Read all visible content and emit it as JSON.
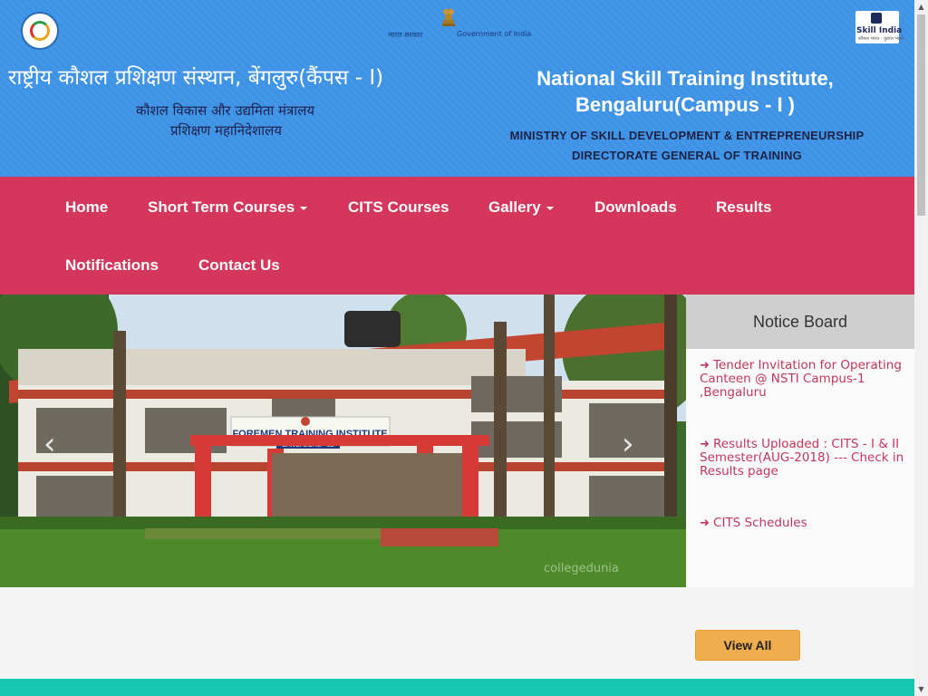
{
  "header": {
    "hindi_title": "राष्ट्रीय कौशल प्रशिक्षण संस्थान, बेंगलुरु(कैंपस - I)",
    "hindi_ministry": "कौशल विकास और उद्यमिता मंत्रालय",
    "hindi_directorate": "प्रशिक्षण महानिदेशालय",
    "english_title_line1": "National Skill Training Institute,",
    "english_title_line2": "Bengaluru(Campus - I )",
    "english_ministry": "MINISTRY OF SKILL DEVELOPMENT & ENTREPRENEURSHIP",
    "english_directorate": "DIRECTORATE GENERAL OF TRAINING",
    "gov_logo_hindi": "भारत सरकार",
    "gov_logo_english": "Government of India",
    "skill_india_text": "Skill India",
    "skill_india_tagline": "कौशल भारत - कुशल भारत"
  },
  "nav": {
    "items": [
      {
        "label": "Home"
      },
      {
        "label": "Short Term Courses"
      },
      {
        "label": "CITS Courses"
      },
      {
        "label": "Gallery"
      },
      {
        "label": "Downloads"
      },
      {
        "label": "Results"
      },
      {
        "label": "Notifications"
      },
      {
        "label": "Contact Us"
      }
    ]
  },
  "carousel": {
    "sign_text": "FOREMEN TRAINING INSTITUTE",
    "sign_subtext": "BANGALORE - 22",
    "watermark": "collegedunia",
    "prev_label": "‹",
    "next_label": "›"
  },
  "notice": {
    "heading": "Notice Board",
    "items": [
      {
        "text": "Tender Invitation for Operating Canteen @ NSTI Campus-1 ,Bengaluru"
      },
      {
        "text": "Results Uploaded : CITS - I & II Semester(AUG-2018) --- Check in Results page"
      },
      {
        "text": "CITS Schedules"
      }
    ],
    "view_all": "View All"
  },
  "colors": {
    "header_bg": "#3e93e6",
    "nav_bg": "#d4365c",
    "notice_link": "#c2375e",
    "button_bg": "#f0ad4e",
    "bottom_bar": "#17c8b0"
  }
}
